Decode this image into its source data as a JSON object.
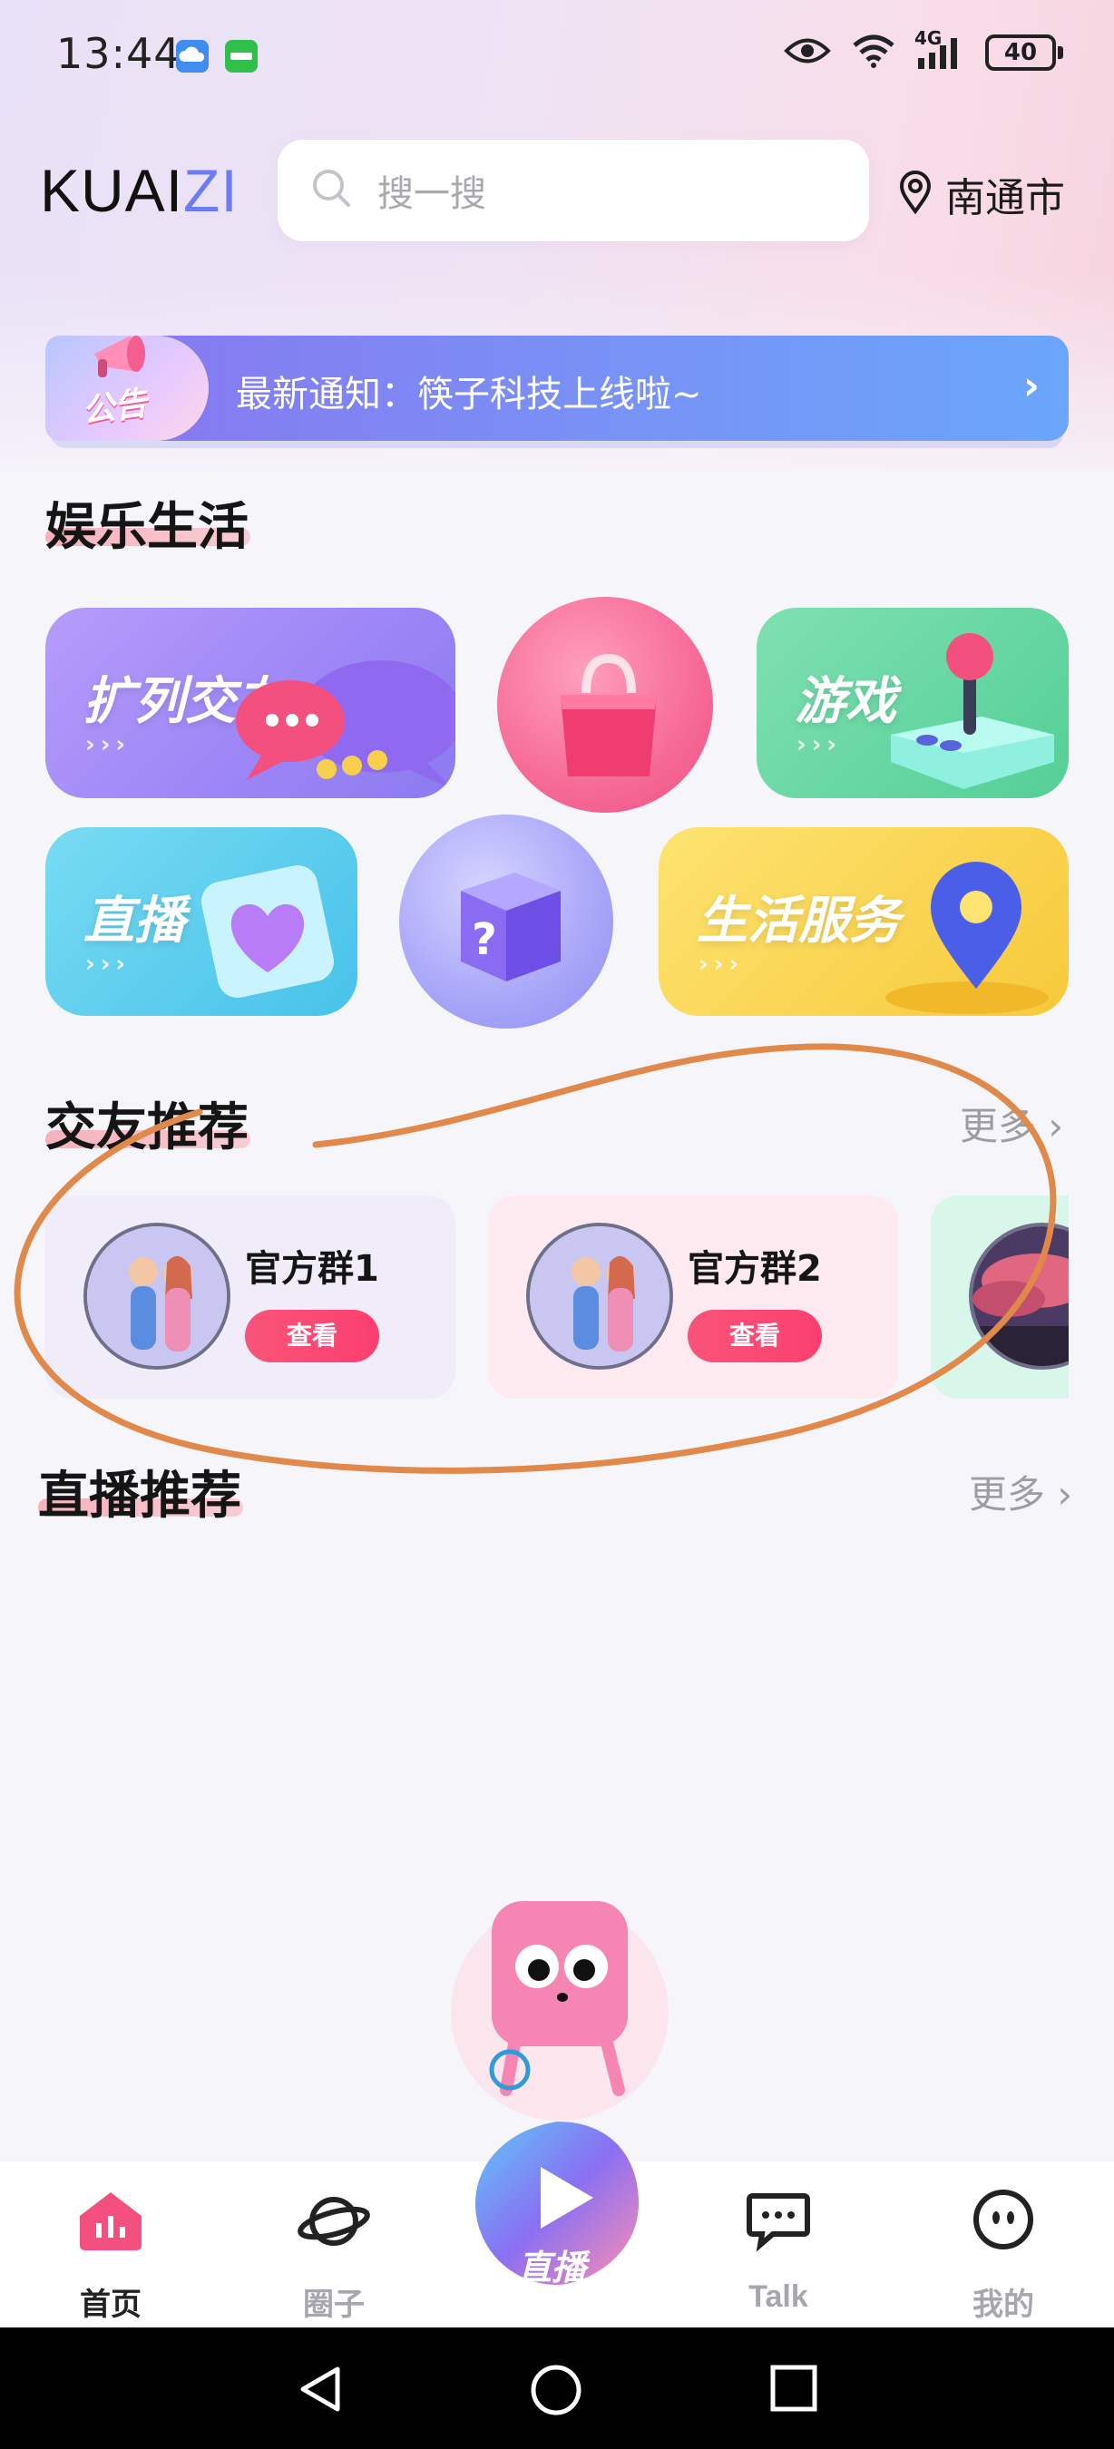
{
  "status_bar": {
    "time": "13:44",
    "network": "4G",
    "battery": "40"
  },
  "header": {
    "logo_main": "KUAI",
    "logo_accent": "ZI",
    "search_placeholder": "搜一搜",
    "location": "南通市"
  },
  "notice": {
    "badge": "公告",
    "text": "最新通知：筷子科技上线啦~"
  },
  "entertainment": {
    "title": "娱乐生活",
    "tiles": [
      {
        "label": "扩列交友",
        "icon": "chat-bubbles-icon"
      },
      {
        "label": "",
        "icon": "shopping-bag-icon"
      },
      {
        "label": "游戏",
        "icon": "joystick-icon"
      },
      {
        "label": "直播",
        "icon": "heart-card-icon"
      },
      {
        "label": "",
        "icon": "mystery-box-icon"
      },
      {
        "label": "生活服务",
        "icon": "location-pin-icon"
      }
    ]
  },
  "friends": {
    "title": "交友推荐",
    "more": "更多",
    "cards": [
      {
        "name": "官方群1",
        "button": "查看"
      },
      {
        "name": "官方群2",
        "button": "查看"
      }
    ]
  },
  "live": {
    "title": "直播推荐",
    "more": "更多"
  },
  "bottom_nav": {
    "items": [
      {
        "label": "首页",
        "icon": "home-icon",
        "active": true
      },
      {
        "label": "圈子",
        "icon": "planet-icon",
        "active": false
      },
      {
        "label": "直播",
        "icon": "live-play-icon",
        "active": false
      },
      {
        "label": "Talk",
        "icon": "chat-icon",
        "active": false
      },
      {
        "label": "我的",
        "icon": "profile-face-icon",
        "active": false
      }
    ]
  },
  "colors": {
    "accent_pink": "#f9547a",
    "nav_active": "#222222",
    "nav_inactive": "#a6a6ad",
    "annotation_stroke": "#e0894a"
  }
}
